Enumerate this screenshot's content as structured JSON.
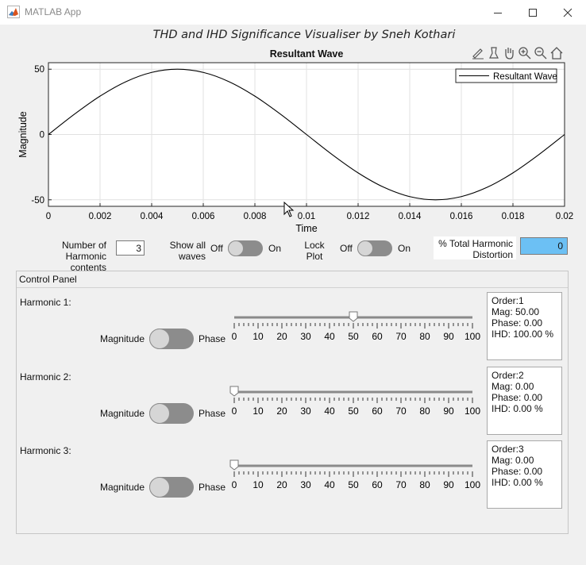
{
  "window": {
    "title": "MATLAB App"
  },
  "app": {
    "heading": "THD and IHD Significance Visualiser by Sneh Kothari"
  },
  "plot": {
    "title": "Resultant Wave",
    "xlabel": "Time",
    "ylabel": "Magnitude",
    "toolbar_icons": [
      "brush-icon",
      "data-tips-icon",
      "pan-hand-icon",
      "zoom-in-icon",
      "zoom-out-icon",
      "home-restore-icon"
    ]
  },
  "chart_data": {
    "type": "line",
    "title": "Resultant Wave",
    "xlabel": "Time",
    "ylabel": "Magnitude",
    "xlim": [
      0,
      0.02
    ],
    "ylim": [
      -55,
      55
    ],
    "xticks": [
      "0",
      "0.002",
      "0.004",
      "0.006",
      "0.008",
      "0.01",
      "0.012",
      "0.014",
      "0.016",
      "0.018",
      "0.02"
    ],
    "yticks": [
      "50",
      "0",
      "-50"
    ],
    "grid": true,
    "legend": "top-right",
    "series": [
      {
        "name": "Resultant Wave",
        "color": "#000000",
        "x": [
          0,
          0.001,
          0.002,
          0.003,
          0.004,
          0.005,
          0.006,
          0.007,
          0.008,
          0.009,
          0.01,
          0.011,
          0.012,
          0.013,
          0.014,
          0.015,
          0.016,
          0.017,
          0.018,
          0.019,
          0.02
        ],
        "y": [
          0,
          15.45,
          29.39,
          40.45,
          47.55,
          50,
          47.55,
          40.45,
          29.39,
          15.45,
          0,
          -15.45,
          -29.39,
          -40.45,
          -47.55,
          -50,
          -47.55,
          -40.45,
          -29.39,
          -15.45,
          0
        ]
      }
    ]
  },
  "controls": {
    "num_harmonics_label_line1": "Number of",
    "num_harmonics_label_line2": "Harmonic contents",
    "num_harmonics_value": "3",
    "show_all_label_line1": "Show all",
    "show_all_label_line2": "waves",
    "switch_off": "Off",
    "switch_on": "On",
    "lock_label_line1": "Lock",
    "lock_label_line2": "Plot",
    "thd_label_line1": "% Total Harmonic",
    "thd_label_line2": "Distortion",
    "thd_value": "0"
  },
  "control_panel": {
    "title": "Control Panel",
    "slider_ticks": [
      "0",
      "10",
      "20",
      "30",
      "40",
      "50",
      "60",
      "70",
      "80",
      "90",
      "100"
    ],
    "magnitude_label": "Magnitude",
    "phase_label": "Phase",
    "harmonics": [
      {
        "label": "Harmonic 1:",
        "slider_value": 50,
        "info": [
          "Order:1",
          "Mag: 50.00",
          "Phase: 0.00",
          "IHD: 100.00 %"
        ]
      },
      {
        "label": "Harmonic 2:",
        "slider_value": 0,
        "info": [
          "Order:2",
          "Mag: 0.00",
          "Phase: 0.00",
          "IHD: 0.00 %"
        ]
      },
      {
        "label": "Harmonic 3:",
        "slider_value": 0,
        "info": [
          "Order:3",
          "Mag: 0.00",
          "Phase: 0.00",
          "IHD: 0.00 %"
        ]
      }
    ]
  }
}
